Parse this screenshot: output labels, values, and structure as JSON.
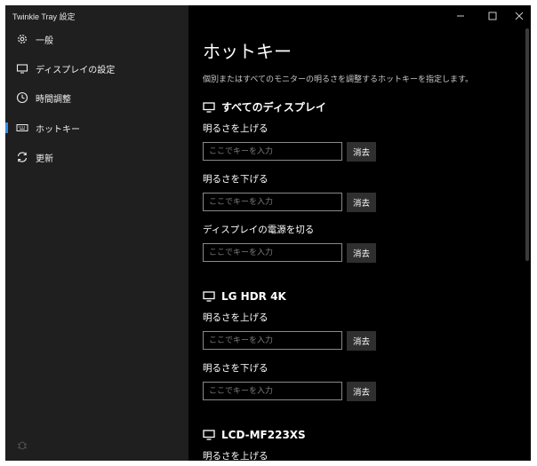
{
  "window": {
    "title": "Twinkle Tray 設定"
  },
  "sidebar": {
    "items": [
      {
        "label": "一般",
        "icon": "gear-icon"
      },
      {
        "label": "ディスプレイの設定",
        "icon": "monitor-icon"
      },
      {
        "label": "時間調整",
        "icon": "clock-icon"
      },
      {
        "label": "ホットキー",
        "icon": "keyboard-icon",
        "active": true
      },
      {
        "label": "更新",
        "icon": "refresh-icon"
      }
    ],
    "bottom_icon": "bug-icon"
  },
  "main": {
    "heading": "ホットキー",
    "description": "個別またはすべてのモニターの明るさを調整するホットキーを指定します。",
    "placeholder": "ここでキーを入力",
    "clear_label": "消去",
    "sections": [
      {
        "title": "すべてのディスプレイ",
        "hotkeys": [
          {
            "label": "明るさを上げる",
            "value": ""
          },
          {
            "label": "明るさを下げる",
            "value": ""
          },
          {
            "label": "ディスプレイの電源を切る",
            "value": ""
          }
        ]
      },
      {
        "title": "LG HDR 4K",
        "hotkeys": [
          {
            "label": "明るさを上げる",
            "value": ""
          },
          {
            "label": "明るさを下げる",
            "value": ""
          }
        ]
      },
      {
        "title": "LCD-MF223XS",
        "hotkeys": [
          {
            "label": "明るさを上げる",
            "value": ""
          }
        ]
      }
    ]
  },
  "colors": {
    "sidebar_bg": "#1f1f1f",
    "main_bg": "#000000",
    "accent": "#3a8ee6",
    "button_bg": "#2f2f2f"
  }
}
